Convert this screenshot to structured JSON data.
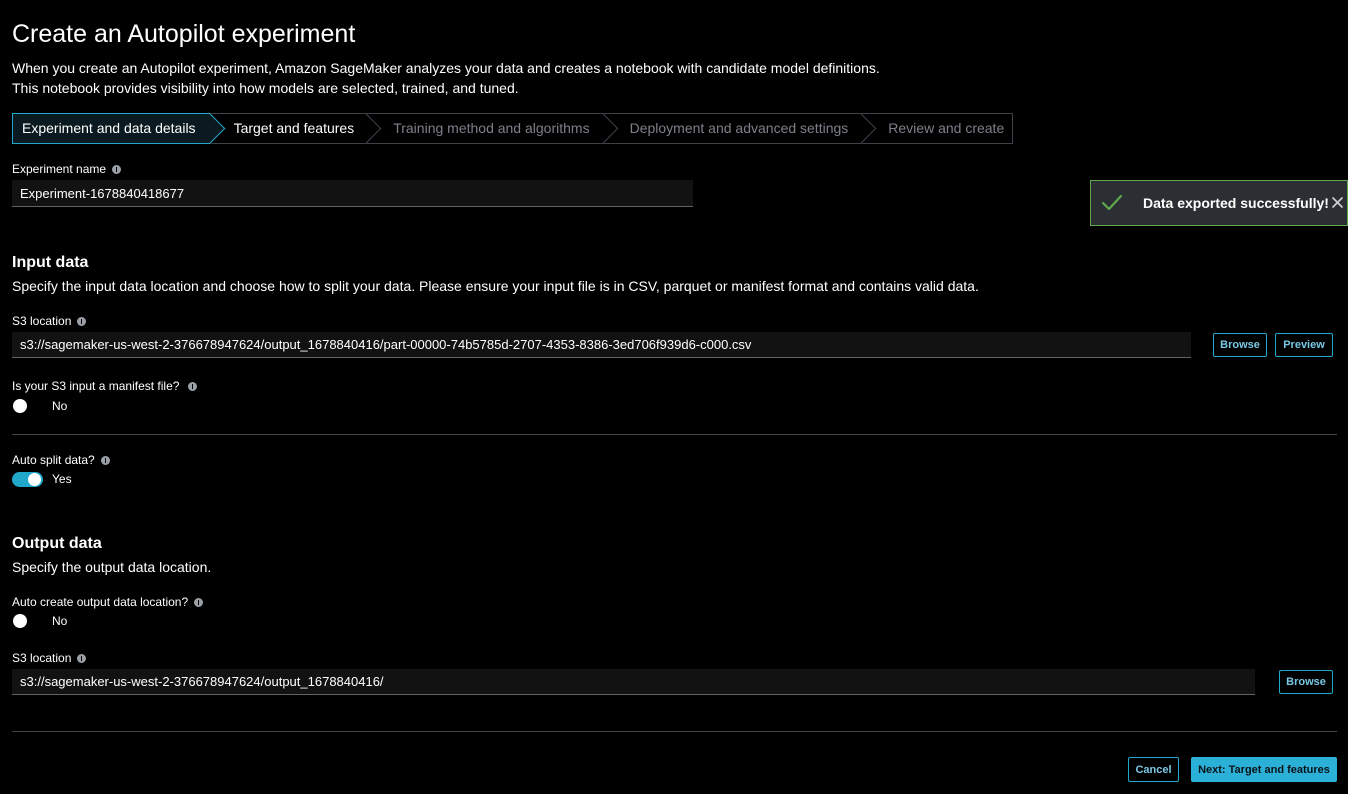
{
  "header": {
    "title": "Create an Autopilot experiment",
    "intro_line1": "When you create an Autopilot experiment, Amazon SageMaker analyzes your data and creates a notebook with candidate model definitions.",
    "intro_line2": "This notebook provides visibility into how models are selected, trained, and tuned."
  },
  "steps": [
    {
      "label": "Experiment and data details",
      "state": "current"
    },
    {
      "label": "Target and features",
      "state": "enabled"
    },
    {
      "label": "Training method and algorithms",
      "state": "disabled"
    },
    {
      "label": "Deployment and advanced settings",
      "state": "disabled"
    },
    {
      "label": "Review and create",
      "state": "disabled"
    }
  ],
  "experiment": {
    "name_label": "Experiment name",
    "name_value": "Experiment-1678840418677"
  },
  "input_data": {
    "heading": "Input data",
    "description": "Specify the input data location and choose how to split your data. Please ensure your input file is in CSV, parquet or manifest format and contains valid data.",
    "s3_label": "S3 location",
    "s3_value": "s3://sagemaker-us-west-2-376678947624/output_1678840416/part-00000-74b5785d-2707-4353-8386-3ed706f939d6-c000.csv",
    "browse_label": "Browse",
    "preview_label": "Preview",
    "manifest_label": "Is your S3 input a manifest file?",
    "manifest_value": "No",
    "auto_split_label": "Auto split data?",
    "auto_split_value": "Yes"
  },
  "output_data": {
    "heading": "Output data",
    "description": "Specify the output data location.",
    "auto_create_label": "Auto create output data location?",
    "auto_create_value": "No",
    "s3_label": "S3 location",
    "s3_value": "s3://sagemaker-us-west-2-376678947624/output_1678840416/",
    "browse_label": "Browse"
  },
  "footer": {
    "cancel_label": "Cancel",
    "next_label": "Next: Target and features"
  },
  "toast": {
    "message": "Data exported successfully!",
    "icon": "check-icon",
    "close_icon": "close-icon",
    "border_color": "#5fa84d"
  },
  "colors": {
    "accent": "#20a7c9",
    "background": "#000000"
  }
}
